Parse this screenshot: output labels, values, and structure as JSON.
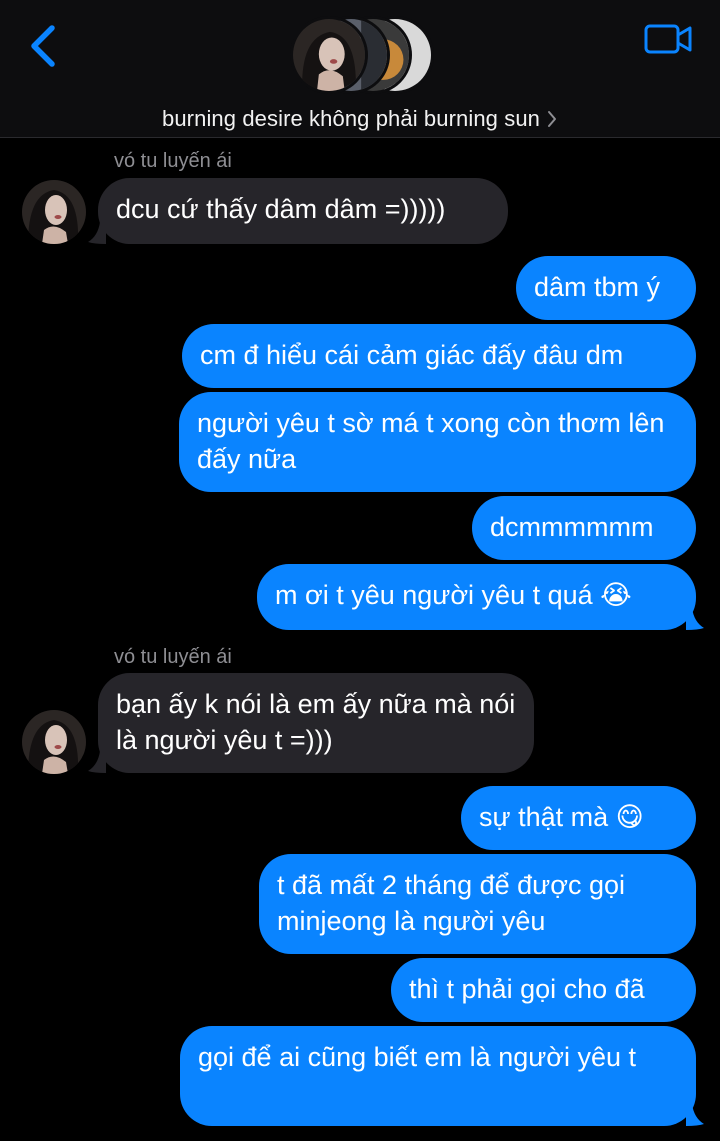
{
  "header": {
    "title": "burning desire không phải burning sun",
    "back_icon": "chevron-left-icon",
    "video_icon": "video-camera-icon",
    "accent_color": "#0a84ff"
  },
  "messages": [
    {
      "type": "sender",
      "text": "vó tu luyến ái"
    },
    {
      "type": "incoming",
      "text": "dcu cứ thấy dâm dâm =)))))"
    },
    {
      "type": "outgoing",
      "text": "dâm tbm ý"
    },
    {
      "type": "outgoing",
      "text": "cm đ hiểu cái cảm giác đấy đâu dm"
    },
    {
      "type": "outgoing",
      "text": "người yêu t sờ má t xong còn thơm lên đấy nữa"
    },
    {
      "type": "outgoing",
      "text": "dcmmmmmm"
    },
    {
      "type": "outgoing",
      "text": "m ơi t yêu người yêu t quá 😭"
    },
    {
      "type": "sender",
      "text": "vó tu luyến ái"
    },
    {
      "type": "incoming",
      "text": "bạn ấy k nói là em ấy nữa mà nói là người yêu t =)))"
    },
    {
      "type": "outgoing",
      "text": "sự thật mà 😋"
    },
    {
      "type": "outgoing",
      "text": "t đã mất 2 tháng để được gọi minjeong là người yêu"
    },
    {
      "type": "outgoing",
      "text": "thì t phải gọi cho đã"
    },
    {
      "type": "outgoing",
      "text": "gọi để ai cũng biết em là người yêu t"
    }
  ],
  "colors": {
    "incoming_bubble": "#26252a",
    "outgoing_bubble": "#0a84ff",
    "sender_name": "#8e8e93"
  }
}
